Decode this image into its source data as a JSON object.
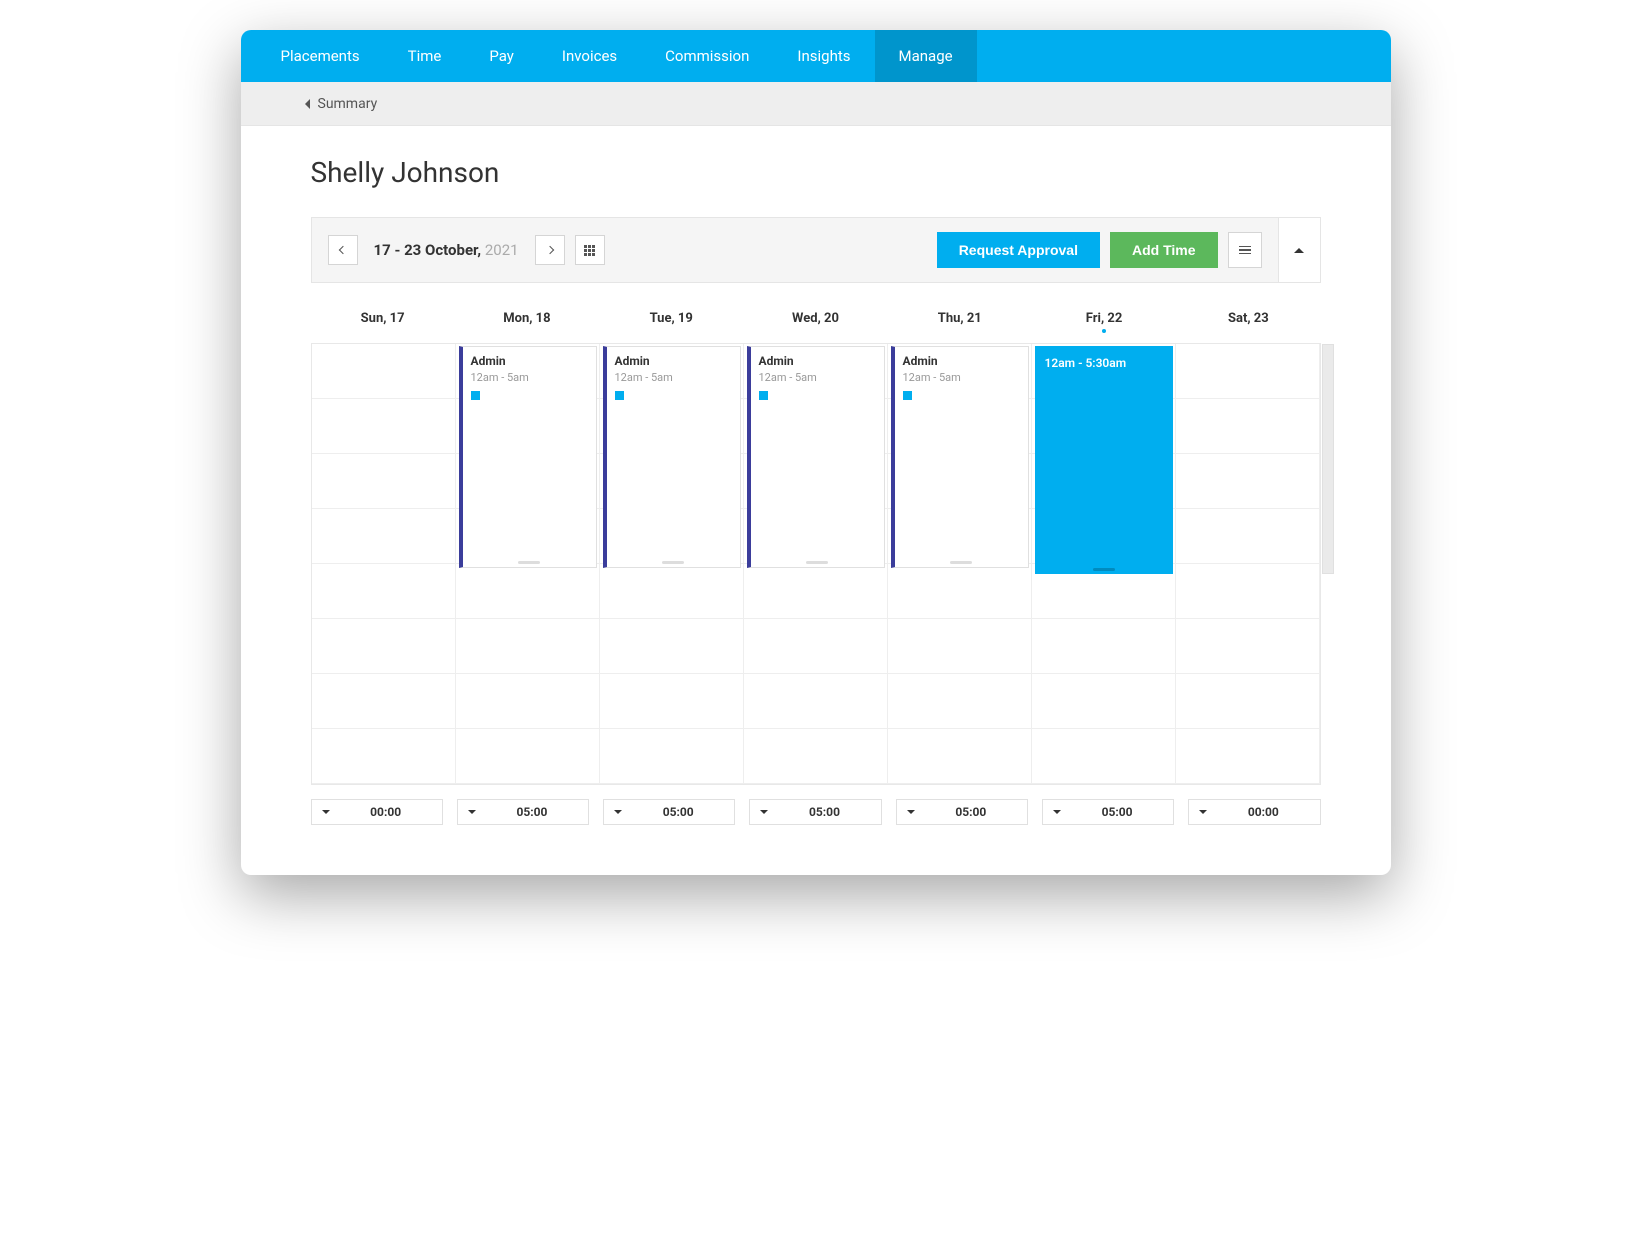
{
  "nav": {
    "items": [
      {
        "label": "Placements",
        "active": false
      },
      {
        "label": "Time",
        "active": false
      },
      {
        "label": "Pay",
        "active": false
      },
      {
        "label": "Invoices",
        "active": false
      },
      {
        "label": "Commission",
        "active": false
      },
      {
        "label": "Insights",
        "active": false
      },
      {
        "label": "Manage",
        "active": true
      }
    ]
  },
  "breadcrumb": {
    "label": "Summary"
  },
  "page": {
    "title": "Shelly Johnson"
  },
  "toolbar": {
    "date_range": "17 - 23 October,",
    "year": "2021",
    "request_approval": "Request Approval",
    "add_time": "Add Time"
  },
  "calendar": {
    "days": [
      {
        "label": "Sun, 17",
        "highlight": false
      },
      {
        "label": "Mon, 18",
        "highlight": false
      },
      {
        "label": "Tue, 19",
        "highlight": false
      },
      {
        "label": "Wed, 20",
        "highlight": false
      },
      {
        "label": "Thu, 21",
        "highlight": false
      },
      {
        "label": "Fri, 22",
        "highlight": true
      },
      {
        "label": "Sat, 23",
        "highlight": false
      }
    ],
    "events": {
      "mon": {
        "title": "Admin",
        "time": "12am - 5am"
      },
      "tue": {
        "title": "Admin",
        "time": "12am - 5am"
      },
      "wed": {
        "title": "Admin",
        "time": "12am - 5am"
      },
      "thu": {
        "title": "Admin",
        "time": "12am - 5am"
      },
      "fri": {
        "time": "12am - 5:30am"
      }
    }
  },
  "totals": [
    {
      "value": "00:00"
    },
    {
      "value": "05:00"
    },
    {
      "value": "05:00"
    },
    {
      "value": "05:00"
    },
    {
      "value": "05:00"
    },
    {
      "value": "05:00"
    },
    {
      "value": "00:00"
    }
  ],
  "colors": {
    "brand": "#00aeef",
    "brand_dark": "#0095cc",
    "event_accent": "#3b3d9b",
    "green": "#5cb85c"
  }
}
